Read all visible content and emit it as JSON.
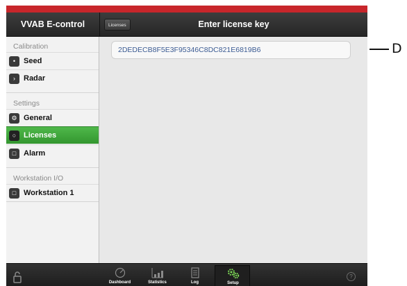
{
  "header": {
    "app_title": "VVAB E-control",
    "back_button": "Licenses",
    "page_title": "Enter license key"
  },
  "sidebar": {
    "sections": [
      {
        "title": "Calibration",
        "items": [
          {
            "label": "Seed",
            "icon": "seed-icon"
          },
          {
            "label": "Radar",
            "icon": "radar-icon"
          }
        ]
      },
      {
        "title": "Settings",
        "items": [
          {
            "label": "General",
            "icon": "gear-icon"
          },
          {
            "label": "Licenses",
            "icon": "license-icon",
            "selected": true
          },
          {
            "label": "Alarm",
            "icon": "alarm-icon"
          }
        ]
      },
      {
        "title": "Workstation I/O",
        "items": [
          {
            "label": "Workstation 1",
            "icon": "workstation-icon"
          }
        ]
      }
    ]
  },
  "license_field": {
    "value": "2DEDECB8F5E3F95346C8DC821E6819B6"
  },
  "tabbar": {
    "tabs": [
      {
        "label": "Dashboard",
        "icon": "dashboard-icon"
      },
      {
        "label": "Statistics",
        "icon": "statistics-icon"
      },
      {
        "label": "Log",
        "icon": "log-icon"
      },
      {
        "label": "Setup",
        "icon": "setup-gears-icon",
        "selected": true
      }
    ],
    "help": "?"
  },
  "callout": {
    "label": "D"
  },
  "colors": {
    "accent_red": "#c8262b",
    "active_green": "#3fa83a",
    "setup_icon": "#7ed957",
    "key_text": "#3b5b93"
  }
}
